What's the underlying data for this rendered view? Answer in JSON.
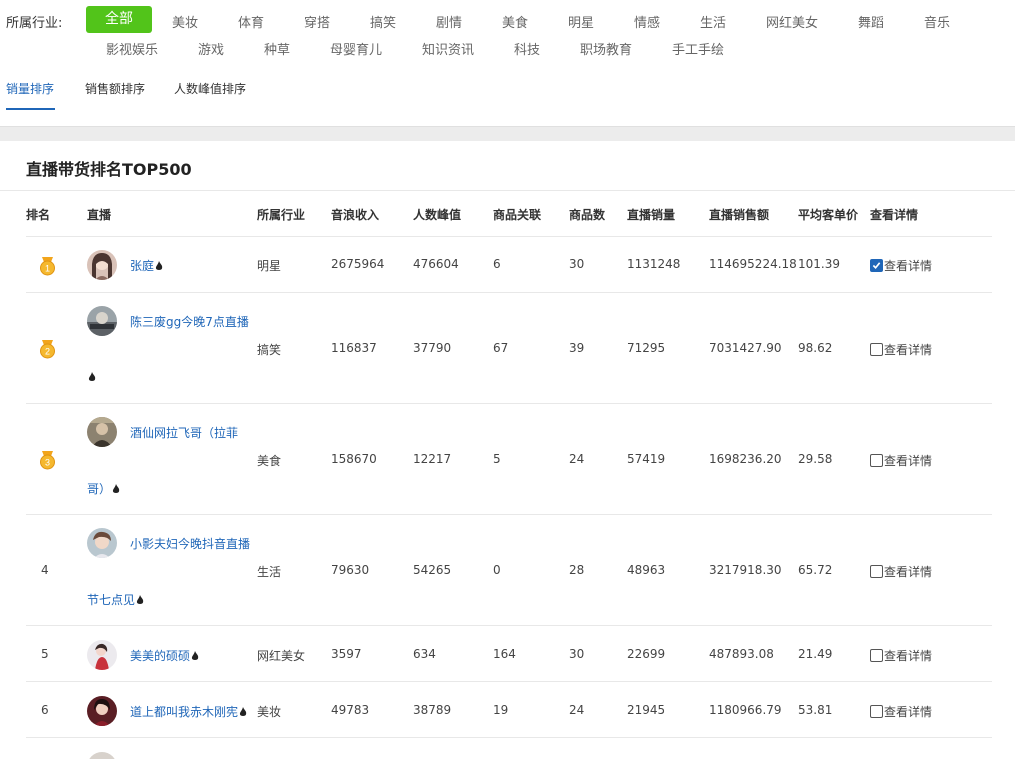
{
  "filter": {
    "label": "所属行业:",
    "tags": [
      "全部",
      "美妆",
      "体育",
      "穿搭",
      "搞笑",
      "剧情",
      "美食",
      "明星",
      "情感",
      "生活",
      "网红美女",
      "舞蹈",
      "音乐",
      "影视娱乐",
      "游戏",
      "种草",
      "母婴育儿",
      "知识资讯",
      "科技",
      "职场教育",
      "手工手绘"
    ],
    "active_tag": "全部"
  },
  "sort_tabs": [
    "销量排序",
    "销售额排序",
    "人数峰值排序"
  ],
  "active_sort": "销量排序",
  "section_title": "直播带货排名TOP500",
  "columns": [
    "排名",
    "直播",
    "所属行业",
    "音浪收入",
    "人数峰值",
    "商品关联",
    "商品数",
    "直播销量",
    "直播销售额",
    "平均客单价",
    "查看详情"
  ],
  "rows": [
    {
      "rank": "1",
      "anchor_line1": "张庭",
      "anchor_line2": "",
      "industry": "明星",
      "yinlang": "2675964",
      "peak": "476604",
      "linked": "6",
      "goods": "30",
      "sales": "1131248",
      "revenue": "114695224.18",
      "avg": "101.39",
      "detail": "查看详情",
      "checked": true
    },
    {
      "rank": "2",
      "anchor_line1": "陈三废gg今晚7点直播",
      "anchor_line2": "",
      "industry": "搞笑",
      "yinlang": "116837",
      "peak": "37790",
      "linked": "67",
      "goods": "39",
      "sales": "71295",
      "revenue": "7031427.90",
      "avg": "98.62",
      "detail": "查看详情",
      "checked": false
    },
    {
      "rank": "3",
      "anchor_line1": "酒仙网拉飞哥（拉菲",
      "anchor_line2": "哥）",
      "industry": "美食",
      "yinlang": "158670",
      "peak": "12217",
      "linked": "5",
      "goods": "24",
      "sales": "57419",
      "revenue": "1698236.20",
      "avg": "29.58",
      "detail": "查看详情",
      "checked": false
    },
    {
      "rank": "4",
      "anchor_line1": "小影夫妇今晚抖音直播",
      "anchor_line2": "节七点见",
      "industry": "生活",
      "yinlang": "79630",
      "peak": "54265",
      "linked": "0",
      "goods": "28",
      "sales": "48963",
      "revenue": "3217918.30",
      "avg": "65.72",
      "detail": "查看详情",
      "checked": false
    },
    {
      "rank": "5",
      "anchor_line1": "美美的硕硕",
      "anchor_line2": "",
      "industry": "网红美女",
      "yinlang": "3597",
      "peak": "634",
      "linked": "164",
      "goods": "30",
      "sales": "22699",
      "revenue": "487893.08",
      "avg": "21.49",
      "detail": "查看详情",
      "checked": false
    },
    {
      "rank": "6",
      "anchor_line1": "道上都叫我赤木刚宪",
      "anchor_line2": "",
      "industry": "美妆",
      "yinlang": "49783",
      "peak": "38789",
      "linked": "19",
      "goods": "24",
      "sales": "21945",
      "revenue": "1180966.79",
      "avg": "53.81",
      "detail": "查看详情",
      "checked": false
    }
  ],
  "colors": {
    "accent_green": "#52c41a",
    "link_blue": "#1f66b8",
    "medal_gold": "#f2a51c"
  }
}
